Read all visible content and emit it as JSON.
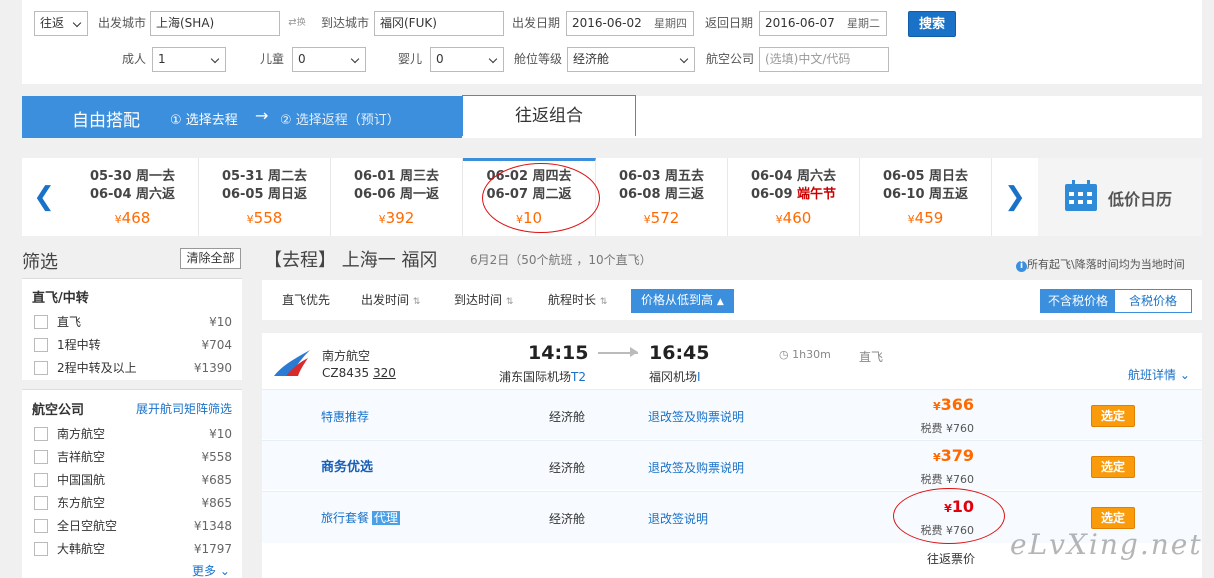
{
  "search": {
    "trip_type": "往返",
    "depart_city_label": "出发城市",
    "depart_city": "上海(SHA)",
    "swap_label": "换",
    "arrive_city_label": "到达城市",
    "arrive_city": "福冈(FUK)",
    "depart_date_label": "出发日期",
    "depart_date": "2016-06-02",
    "depart_weekday": "星期四",
    "return_date_label": "返回日期",
    "return_date": "2016-06-07",
    "return_weekday": "星期二",
    "search_button": "搜索",
    "adult_label": "成人",
    "adult_value": "1",
    "child_label": "儿童",
    "child_value": "0",
    "infant_label": "婴儿",
    "infant_value": "0",
    "cabin_label": "舱位等级",
    "cabin_value": "经济舱",
    "airline_label": "航空公司",
    "airline_placeholder": "(选填)中文/代码"
  },
  "mode": {
    "title": "自由搭配",
    "step1": "① 选择去程",
    "arrow": "→",
    "step2": "② 选择返程（预订）",
    "combo_tab": "往返组合"
  },
  "date_strip": {
    "cells": [
      {
        "line1": "05-30 周一去",
        "line2": "06-04 周六返",
        "price": "468"
      },
      {
        "line1": "05-31 周二去",
        "line2": "06-05 周日返",
        "price": "558"
      },
      {
        "line1": "06-01 周三去",
        "line2": "06-06 周一返",
        "price": "392"
      },
      {
        "line1": "06-02 周四去",
        "line2": "06-07 周二返",
        "price": "10"
      },
      {
        "line1": "06-03 周五去",
        "line2": "06-08 周三返",
        "price": "572"
      },
      {
        "line1": "06-04 周六去",
        "line2_date": "06-09",
        "line2_holiday": "端午节",
        "price": "460"
      },
      {
        "line1": "06-05 周日去",
        "line2": "06-10 周五返",
        "price": "459"
      }
    ],
    "currency": "¥",
    "calendar_label": "低价日历"
  },
  "sidebar": {
    "title": "筛选",
    "clear_all": "清除全部",
    "stops_title": "直飞/中转",
    "stops": [
      {
        "name": "直飞",
        "price": "¥10"
      },
      {
        "name": "1程中转",
        "price": "¥704"
      },
      {
        "name": "2程中转及以上",
        "price": "¥1390"
      }
    ],
    "airlines_title": "航空公司",
    "airlines_link": "展开航司矩阵筛选",
    "airlines": [
      {
        "name": "南方航空",
        "price": "¥10"
      },
      {
        "name": "吉祥航空",
        "price": "¥558"
      },
      {
        "name": "中国国航",
        "price": "¥685"
      },
      {
        "name": "东方航空",
        "price": "¥865"
      },
      {
        "name": "全日空航空",
        "price": "¥1348"
      },
      {
        "name": "大韩航空",
        "price": "¥1797"
      }
    ],
    "more": "更多"
  },
  "result_header": {
    "title": "【去程】 上海一 福冈",
    "summary": "6月2日（50个航班 ，10个直飞）",
    "note": "所有起飞\\降落时间均为当地时间"
  },
  "sort": {
    "direct_first": "直飞优先",
    "depart_time": "出发时间",
    "arrive_time": "到达时间",
    "duration": "航程时长",
    "price": "价格从低到高",
    "excl_tax": "不含税价格",
    "incl_tax": "含税价格"
  },
  "flight": {
    "airline": "南方航空",
    "flight_no": "CZ8435",
    "aircraft": "320",
    "depart_time": "14:15",
    "arrive_time": "16:45",
    "depart_airport": "浦东国际机场",
    "depart_terminal": "T2",
    "arrive_airport": "福冈机场",
    "arrive_terminal": "I",
    "duration": "1h30m",
    "type": "直飞",
    "details": "航班详情",
    "fares": [
      {
        "name": "特惠推荐",
        "cabin": "经济舱",
        "rules": "退改签及购票说明",
        "price": "366",
        "tax": "税费 ¥760",
        "button": "选定"
      },
      {
        "name": "商务优选",
        "cabin": "经济舱",
        "rules": "退改签及购票说明",
        "price": "379",
        "tax": "税费 ¥760",
        "button": "选定"
      },
      {
        "name": "旅行套餐",
        "badge": "代理",
        "cabin": "经济舱",
        "rules": "退改签说明",
        "price": "10",
        "tax": "税费 ¥760",
        "button": "选定"
      }
    ],
    "round_trip_note": "往返票价"
  },
  "watermark": "eLvXing.net"
}
